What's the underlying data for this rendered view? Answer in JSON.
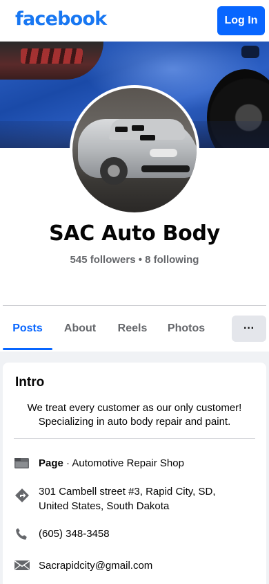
{
  "header": {
    "logo_text": "facebook",
    "login_label": "Log In",
    "brand_color": "#0866ff"
  },
  "cover": {
    "description_icon": "cover-photo"
  },
  "profile": {
    "name": "SAC Auto Body",
    "followers_line": "545 followers • 8 following"
  },
  "tabs": [
    {
      "label": "Posts",
      "active": true
    },
    {
      "label": "About",
      "active": false
    },
    {
      "label": "Reels",
      "active": false
    },
    {
      "label": "Photos",
      "active": false
    }
  ],
  "more_label": "···",
  "intro": {
    "title": "Intro",
    "bio_line1": "We treat every customer as our only customer!",
    "bio_line2": "Specializing in auto body repair and paint.",
    "page_label": "Page",
    "page_category": " · Automotive Repair Shop",
    "address": "301 Cambell street #3, Rapid City, SD, United States, South Dakota",
    "phone": "(605) 348-3458",
    "email": "Sacrapidcity@gmail.com"
  },
  "icons": {
    "page": "flag-page-icon",
    "address": "directions-icon",
    "phone": "phone-icon",
    "email": "envelope-icon"
  }
}
